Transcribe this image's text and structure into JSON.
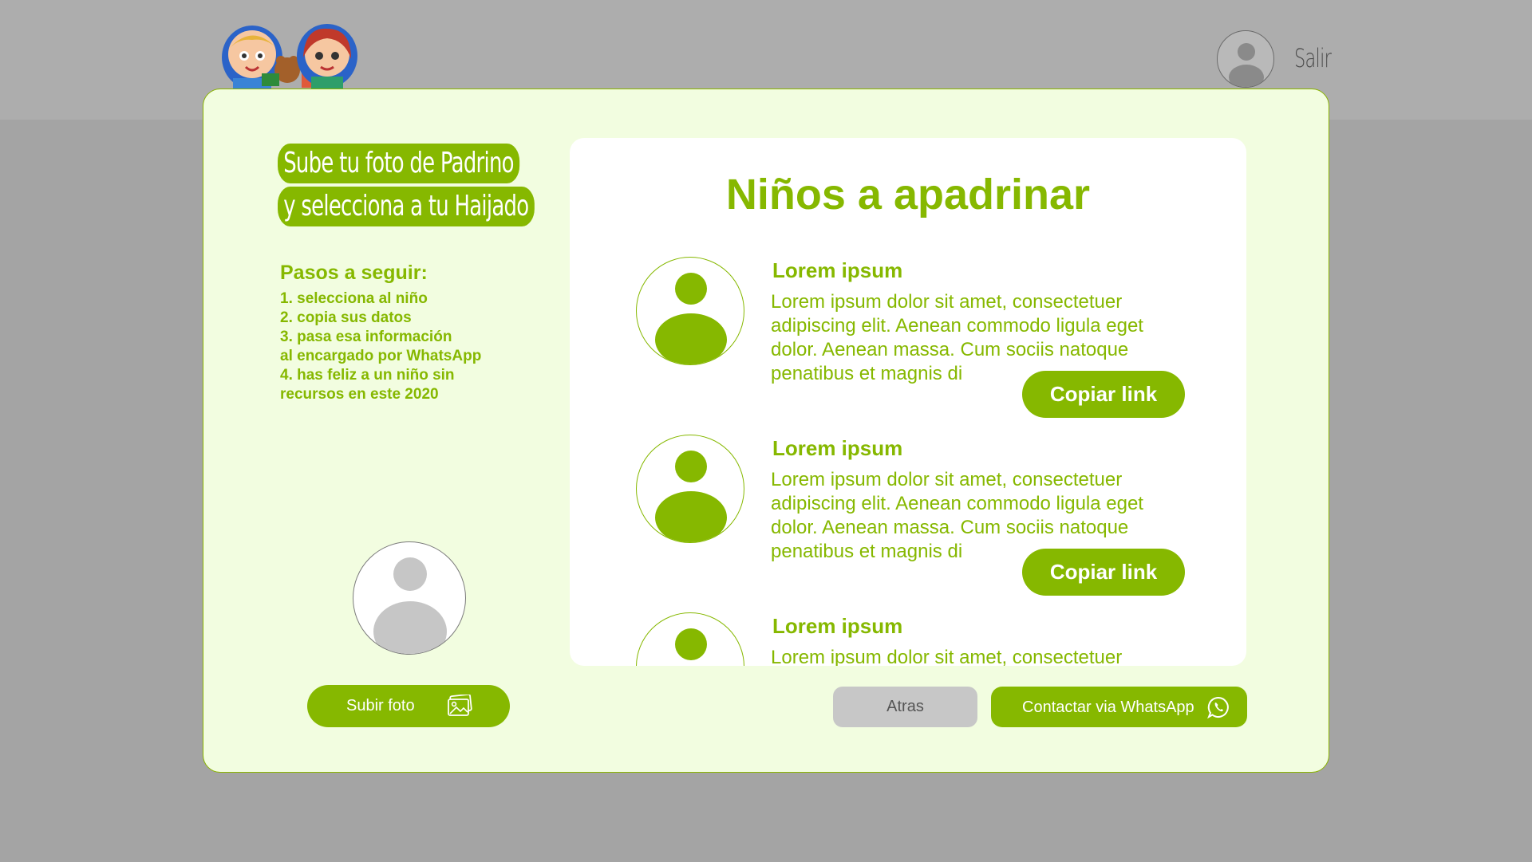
{
  "header": {
    "logout_label": "Salir"
  },
  "left": {
    "title_line1": "Sube tu foto de Padrino",
    "title_line2": "y selecciona a tu Haijado",
    "steps_title": "Pasos a seguir:",
    "steps": [
      "1. selecciona al niño",
      "2. copia sus datos",
      "3. pasa esa información",
      "al encargado por WhatsApp",
      "4. has feliz a un niño sin",
      "recursos en este 2020"
    ],
    "upload_label": "Subir foto"
  },
  "panel": {
    "title": "Niños a apadrinar",
    "children": [
      {
        "name": "Lorem ipsum",
        "description": "Lorem ipsum dolor sit amet, consectetuer adipiscing elit. Aenean commodo ligula eget dolor. Aenean massa. Cum sociis natoque penatibus et magnis di",
        "button": "Copiar link"
      },
      {
        "name": "Lorem ipsum",
        "description": "Lorem ipsum dolor sit amet, consectetuer adipiscing elit. Aenean commodo ligula eget dolor. Aenean massa. Cum sociis natoque penatibus et magnis di",
        "button": "Copiar link"
      },
      {
        "name": "Lorem ipsum",
        "description": "Lorem ipsum dolor sit amet, consectetuer",
        "button": ""
      }
    ]
  },
  "footer": {
    "back_label": "Atras",
    "whatsapp_label": "Contactar via WhatsApp"
  },
  "colors": {
    "accent": "#86b800",
    "modal_bg": "#f2fde0",
    "overlay": "#a4a4a4"
  },
  "icons": [
    "avatar-icon",
    "image-icon",
    "whatsapp-icon",
    "logo-image"
  ]
}
